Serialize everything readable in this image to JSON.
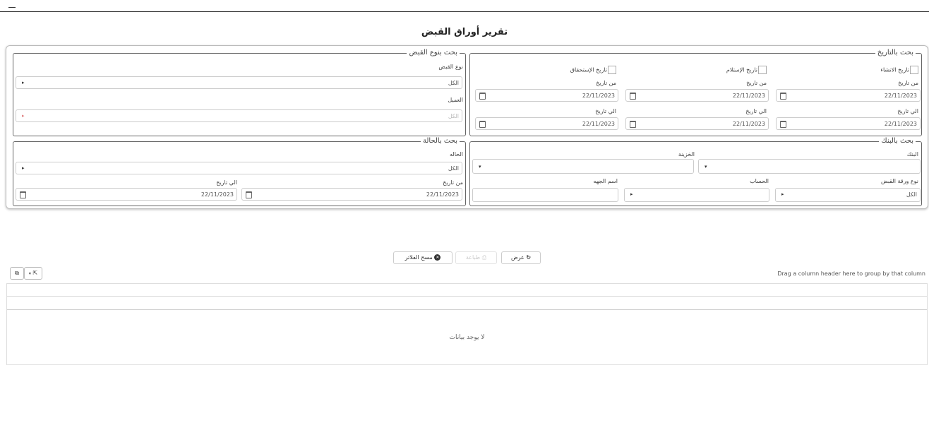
{
  "header": {
    "title": "تقرير أوراق القبض"
  },
  "date_search": {
    "legend": "بحث بالتاريخ",
    "checkboxes": [
      {
        "label": "تاريخ الانشاء",
        "checked": false
      },
      {
        "label": "تاريخ الإستلام",
        "checked": false
      },
      {
        "label": "تاريخ الإستحقاق",
        "checked": false
      }
    ],
    "from_label": "من تاريخ",
    "to_label": "الي تاريخ",
    "date_value": "22/11/2023"
  },
  "type_search": {
    "legend": "بحث بنوع القبض",
    "type_label": "نوع القبض",
    "type_value": "الكل",
    "client_label": "العميل",
    "client_value": "الكل"
  },
  "bank_search": {
    "legend": "بحث بالبنك",
    "bank_label": "البنك",
    "safe_label": "الخزينة",
    "paper_type_label": "نوع ورقة القبض",
    "paper_type_value": "الكل",
    "account_label": "الحساب",
    "party_label": "اسم الجهه"
  },
  "status_search": {
    "legend": "بحث بالحالة",
    "status_label": "الحاله",
    "status_value": "الكل",
    "from_label": "من تاريخ",
    "to_label": "الي تاريخ",
    "date_value": "22/11/2023"
  },
  "actions": {
    "view": "عرض",
    "print": "طباعة",
    "clear": "مسح الفلاتر"
  },
  "grid": {
    "group_hint": "Drag a column header here to group by that column",
    "empty_text": "لا يوجد بيانات"
  }
}
